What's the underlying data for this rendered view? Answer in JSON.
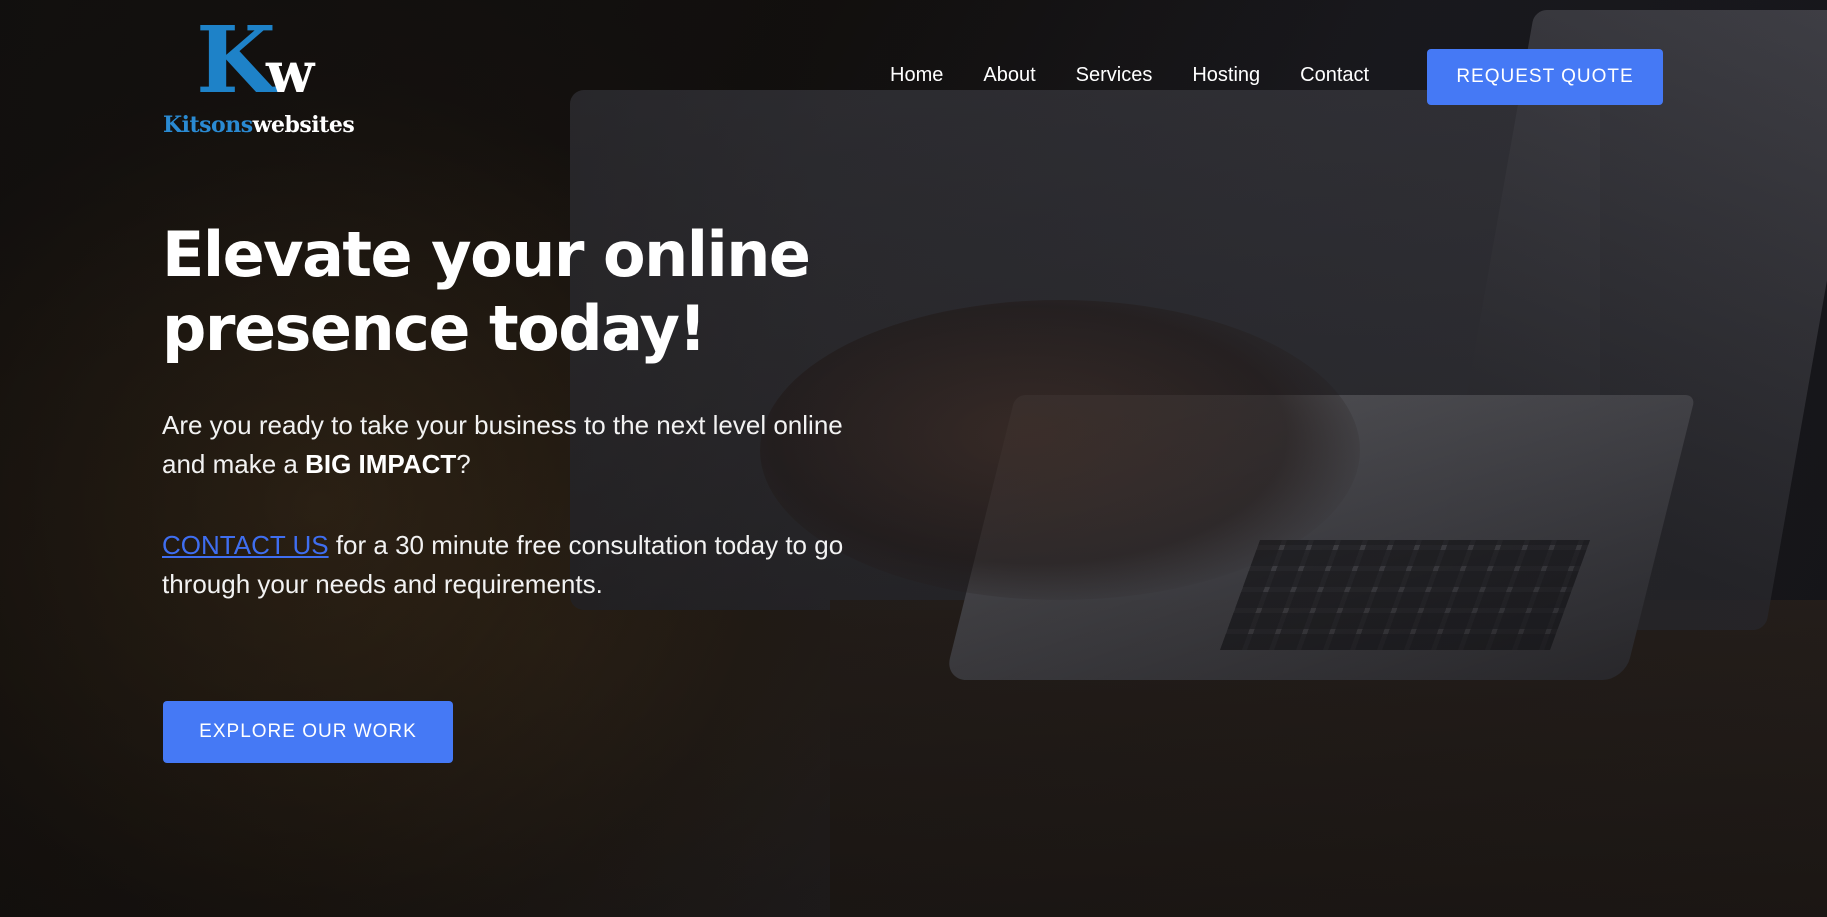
{
  "brand": {
    "logo_k": "K",
    "logo_w": "w",
    "wordmark_part1": "Kitsons",
    "wordmark_part2": "websites",
    "colors": {
      "logo_blue": "#1e82c8",
      "accent": "#4579f5",
      "link": "#3f6ef0"
    }
  },
  "nav": {
    "items": [
      {
        "label": "Home"
      },
      {
        "label": "About"
      },
      {
        "label": "Services"
      },
      {
        "label": "Hosting"
      },
      {
        "label": "Contact"
      }
    ],
    "cta_label": "REQUEST QUOTE"
  },
  "hero": {
    "title_line1": "Elevate your online",
    "title_line2": "presence today!",
    "para1_text": "Are you ready to take your business to the next level online and make a ",
    "para1_emphasis": "BIG IMPACT",
    "para1_end": "?",
    "para2_link": "CONTACT US",
    "para2_text": " for a 30 minute free consultation today to go through your needs and requirements.",
    "cta_label": "EXPLORE OUR WORK",
    "background_image": "laptop-typing-photo"
  }
}
